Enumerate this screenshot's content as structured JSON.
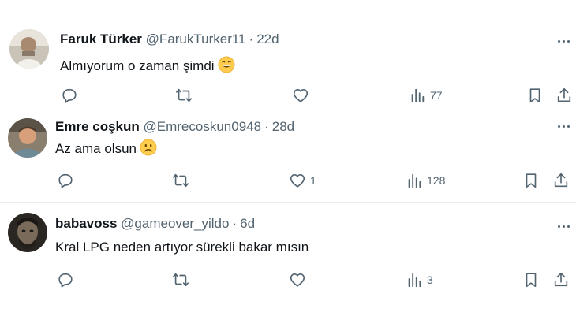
{
  "tweets": [
    {
      "name": "Faruk Türker",
      "handle": "@FarukTurker11",
      "separator": "·",
      "time": "22d",
      "text": "Almıyorum o zaman şimdi",
      "emoji_icon": "grinning-face-icon",
      "reply_count": "",
      "retweet_count": "",
      "like_count": "",
      "views_count": "77"
    },
    {
      "name": "Emre coşkun",
      "handle": "@Emrecoskun0948",
      "separator": "·",
      "time": "28d",
      "text": "Az ama olsun",
      "emoji_icon": "slightly-frowning-face-icon",
      "reply_count": "",
      "retweet_count": "",
      "like_count": "1",
      "views_count": "128"
    },
    {
      "name": "babavoss",
      "handle": "@gameover_yildo",
      "separator": "·",
      "time": "6d",
      "text": "Kral LPG neden artıyor sürekli bakar mısın",
      "emoji_icon": "",
      "reply_count": "",
      "retweet_count": "",
      "like_count": "",
      "views_count": "3"
    }
  ],
  "colors": {
    "text": "#0f1419",
    "secondary": "#536471",
    "divider": "#e6ecf0",
    "emoji": "#ffcc4d"
  }
}
